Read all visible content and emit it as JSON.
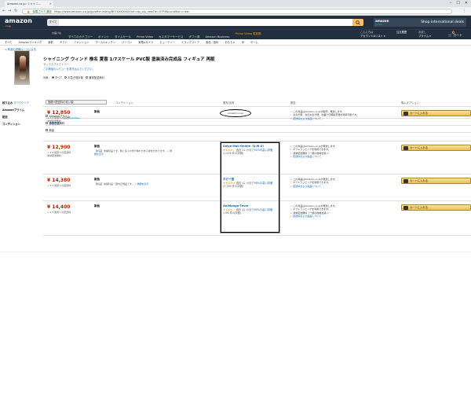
{
  "browser": {
    "tab_title": "Amazon.co.jp: シャイニ...",
    "window_buttons": [
      "–",
      "☐",
      "✕"
    ],
    "secure_label": "保護された通信",
    "url": "https://www.amazon.co.jp/gp/offer-listing/B07XXXXXXX/ref=dp_olp_new?ie=UTF8&condition=new"
  },
  "amazon": {
    "logo": "amazon",
    "logo_sub": ".co.jp",
    "search_category": "すべて",
    "search_placeholder": "",
    "prime_banner": {
      "brand": "amazon",
      "sub": "global",
      "text": "Shop international deals"
    },
    "location": "お届け先",
    "nav_links": [
      "すべてのカテゴリー",
      "ポイント",
      "タイムセール",
      "Prime Video",
      "カスタマーサービス",
      "ギフト券",
      "Amazon Business"
    ],
    "promo": "Prime Video 見放題",
    "account": {
      "small": "こんにちは",
      "label": "アカウント&リスト ▾"
    },
    "orders": {
      "small": "",
      "label": "注文履歴"
    },
    "prime": {
      "small": "お試し",
      "label": "プライム ▾"
    },
    "cart": {
      "count": "0",
      "label": "カート"
    },
    "subnav": [
      "すべて",
      "Amazonランキング",
      "新着",
      "ギフト",
      "ファッション",
      "ホーム&キッチン",
      "パソコン",
      "家電&カメラ",
      "ビューティー",
      "ドラッグストア",
      "食品・飲料",
      "おもちゃ",
      "本",
      "ゲーム"
    ]
  },
  "product": {
    "breadcrumb": "< 商品の詳細ページに戻る",
    "title": "シャイニング ウィンド 椎名 夏香 1/7スケール PVC製 塗装済み完成品 フィギュア 再販",
    "subtitle": "マックスファクトリー",
    "review_link": "この商品のレビューを書き込んでください。",
    "filter_label": "対象:",
    "radio_opts": [
      "すべて",
      "お急ぎ便対象",
      "通常配送無料"
    ]
  },
  "filters": {
    "heading": "絞り込み",
    "clear": "すべてクリア",
    "prime_heading": "Amazonプライム",
    "prime_opt": "Amazonプライム",
    "delivery_heading": "配送",
    "delivery_opts": [
      "お急ぎ便",
      "通常配送無料"
    ],
    "condition_heading": "コンディション",
    "condition_opts": [
      "新品"
    ]
  },
  "listing": {
    "sort_label": "価格+配送料の安い順",
    "col_condition": "コンディション",
    "col_seller": "販売/出荷",
    "col_delivery": "配送",
    "col_purchase": "購入オプション",
    "amazon_badge_text": "Amazon.co.jp",
    "offers": [
      {
        "price": "¥ 12,850",
        "shipping": "+ ¥ 0 関東への配送料",
        "prime": "prime",
        "ship_note": "通常配送無料",
        "condition": "新品",
        "desc": "",
        "seller_name": "Amazon.co.jp",
        "stars": "",
        "rating": "",
        "delivery": [
          "この商品はAmazon.co.jpが販売、発送します。",
          "お急ぎ便、当日お急ぎ便、お届け日時指定便を利用可能です。",
          "配送料および返品について"
        ],
        "cart_label": "カートに入れる"
      },
      {
        "price": "¥ 12,900",
        "shipping": "+ ¥ 0 関東への配送料",
        "prime": "",
        "ship_note": "通常配送無料",
        "condition": "新品",
        "desc": "【新品】未開封品です。箱に多少の傷や擦れがある場合があります。",
        "desc_more": "» 詳細を表示",
        "seller_name": "Seiya Mall Online（S.M.O）",
        "stars": "★★★★☆",
        "rating": "過去 12 カ月で",
        "rating_link": "91%の高い評価",
        "rating_count": "(1,028 件の評価)",
        "delivery": [
          "この商品はAmazon.co.jpが発送します。",
          "ギフトラッピングを利用できます。",
          "通常配送無料（一部の地域を除く）",
          "配送料および返品について"
        ],
        "cart_label": "カートに入れる"
      },
      {
        "price": "¥ 14,380",
        "shipping": "+ ¥ 0 関東への配送料",
        "prime": "",
        "ship_note": "",
        "condition": "新品",
        "desc": "【新品】未開封品・国内正規品です。",
        "desc_more": "» 詳細を表示",
        "seller_name": "ホビー堂",
        "stars": "★★★★★",
        "rating": "過去 12 カ月で",
        "rating_link": "98%の高い評価",
        "rating_count": "(3,289 件の評価)",
        "delivery": [
          "この商品はAmazon.co.jpが発送します。",
          "ギフトラッピングを利用できます。",
          "配送料および返品について"
        ],
        "cart_label": "カートに入れる"
      },
      {
        "price": "¥ 14,400",
        "shipping": "+ ¥ 0 関東への配送料",
        "prime": "",
        "ship_note": "",
        "condition": "新品",
        "desc": "",
        "desc_more": "",
        "seller_name": "AniManga Fever",
        "stars": "★★★★☆",
        "rating": "過去 12 カ月で",
        "rating_link": "95%の高い評価",
        "rating_count": "(198 件の評価)",
        "delivery": [
          "この商品はAmazon.co.jpが発送します。",
          "ギフトラッピングを利用できます。",
          "通常配送無料（一部の地域を除く）",
          "配送料および返品について"
        ],
        "cart_label": "カートに入れる"
      }
    ]
  }
}
